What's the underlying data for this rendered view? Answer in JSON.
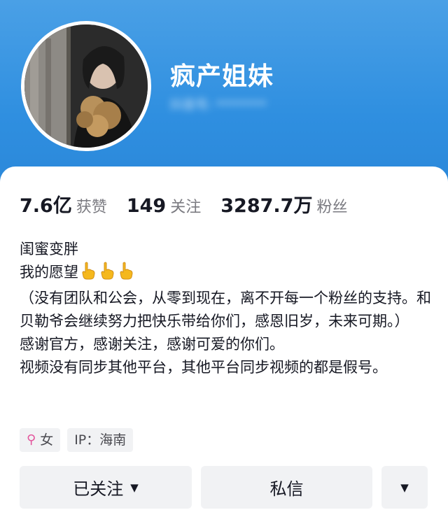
{
  "profile": {
    "name": "疯产姐妹",
    "handle_blurred": "抖音号: ********"
  },
  "stats": [
    {
      "value": "7.6亿",
      "label": "获赞"
    },
    {
      "value": "149",
      "label": "关注"
    },
    {
      "value": "3287.7万",
      "label": "粉丝"
    }
  ],
  "bio": {
    "line1": "闺蜜变胖",
    "line2": "我的愿望",
    "line2_icons": [
      "pointing-hand-icon",
      "pointing-hand-icon",
      "pointing-hand-icon"
    ],
    "line3": "（没有团队和公会，从零到现在，离不开每一个粉丝的支持。和贝勒爷会继续努力把快乐带给你们，感恩旧岁，未来可期。）",
    "line4": "感谢官方，感谢关注，感谢可爱的你们。",
    "line5": "视频没有同步其他平台，其他平台同步视频的都是假号。"
  },
  "tags": {
    "gender_icon": "female-icon",
    "gender": "女",
    "ip": "IP：海南"
  },
  "actions": {
    "follow_label": "已关注",
    "message_label": "私信",
    "dropdown_icon": "caret-down-icon"
  },
  "colors": {
    "header_blue": "#2f8fe0",
    "gender_pink": "#e3559c",
    "button_gray": "#f1f2f4"
  }
}
